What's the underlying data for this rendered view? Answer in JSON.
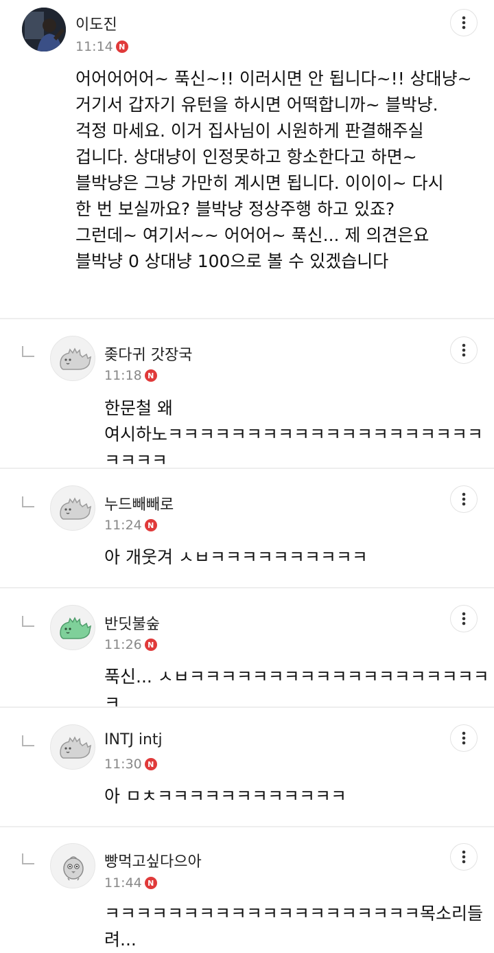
{
  "comments": [
    {
      "author": "이도진",
      "time": "11:14",
      "badge": "N",
      "avatar": "profile-photo",
      "text": "어어어어어~ 푹신~!! 이러시면 안 됩니다~!! 상대냥~\n거기서 갑자기 유턴을 하시면 어떡합니까~ 블박냥.\n걱정 마세요. 이거 집사님이 시원하게 판결해주실\n겁니다. 상대냥이 인정못하고 항소한다고 하면~\n블박냥은 그냥 가만히 계시면 됩니다. 이이이~ 다시\n한 번 보실까요? 블박냥 정상주행 하고 있죠?\n그런데~ 여기서~~ 어어어~ 푹신... 제 의견은요\n블박냥 0 상대냥 100으로 볼 수 있겠습니다"
    },
    {
      "author": "좆다귀 갓장국",
      "time": "11:18",
      "badge": "N",
      "avatar": "gray-dinosaur-icon",
      "text": "한문철 왜\n여시하노ㅋㅋㅋㅋㅋㅋㅋㅋㅋㅋㅋㅋㅋㅋㅋㅋㅋㅋㅋㅋㅋㅋㅋㅋ"
    },
    {
      "author": "누드빼빼로",
      "time": "11:24",
      "badge": "N",
      "avatar": "gray-dinosaur-icon",
      "text": "아 개웃겨 ㅅㅂㅋㅋㅋㅋㅋㅋㅋㅋㅋㅋ"
    },
    {
      "author": "반딧불숲",
      "time": "11:26",
      "badge": "N",
      "avatar": "green-dinosaur-icon",
      "text": "푹신... ㅅㅂㅋㅋㅋㅋㅋㅋㅋㅋㅋㅋㅋㅋㅋㅋㅋㅋㅋㅋㅋㅋ"
    },
    {
      "author": "INTJ intj",
      "time": "11:30",
      "badge": "N",
      "avatar": "gray-dinosaur-icon",
      "text": "아 ㅁㅊㅋㅋㅋㅋㅋㅋㅋㅋㅋㅋㅋㅋ"
    },
    {
      "author": "빵먹고싶다으아",
      "time": "11:44",
      "badge": "N",
      "avatar": "gray-chick-icon",
      "text": "ㅋㅋㅋㅋㅋㅋㅋㅋㅋㅋㅋㅋㅋㅋㅋㅋㅋㅋㅋㅋ목소리들려..."
    }
  ],
  "colors": {
    "badge": "#e03a3a",
    "time": "#888888",
    "divider": "#eeeeee",
    "dino_gray": "#d4d4d4",
    "dino_green": "#7fd09a"
  }
}
